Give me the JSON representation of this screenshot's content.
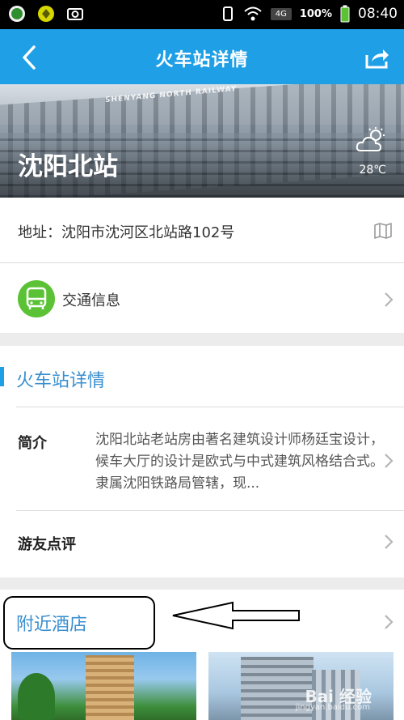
{
  "status_bar": {
    "network": "4G",
    "battery": "100%",
    "time": "08:40"
  },
  "nav": {
    "title": "火车站详情"
  },
  "hero": {
    "station_name": "沈阳北站",
    "building_sign": "SHENYANG NORTH RAILWAY",
    "weather_icon": "partly-cloudy-icon",
    "temperature": "28℃"
  },
  "address": {
    "text": "地址：沈阳市沈河区北站路102号",
    "icon": "map-icon"
  },
  "traffic": {
    "label": "交通信息",
    "icon": "bus-icon",
    "icon_color": "#5bc236"
  },
  "detail_section": {
    "title": "火车站详情",
    "intro_label": "简介",
    "intro_text": "沈阳北站老站房由著名建筑设计师杨廷宝设计，候车大厅的设计是欧式与中式建筑风格结合式。隶属沈阳铁路局管辖，现...",
    "reviews_label": "游友点评"
  },
  "hotels_section": {
    "title": "附近酒店"
  },
  "watermark": {
    "text": "Bai 经验",
    "sub": "jingyan.baidu.com"
  },
  "colors": {
    "accent": "#1e9fe6",
    "section_title": "#3a8fd0"
  }
}
